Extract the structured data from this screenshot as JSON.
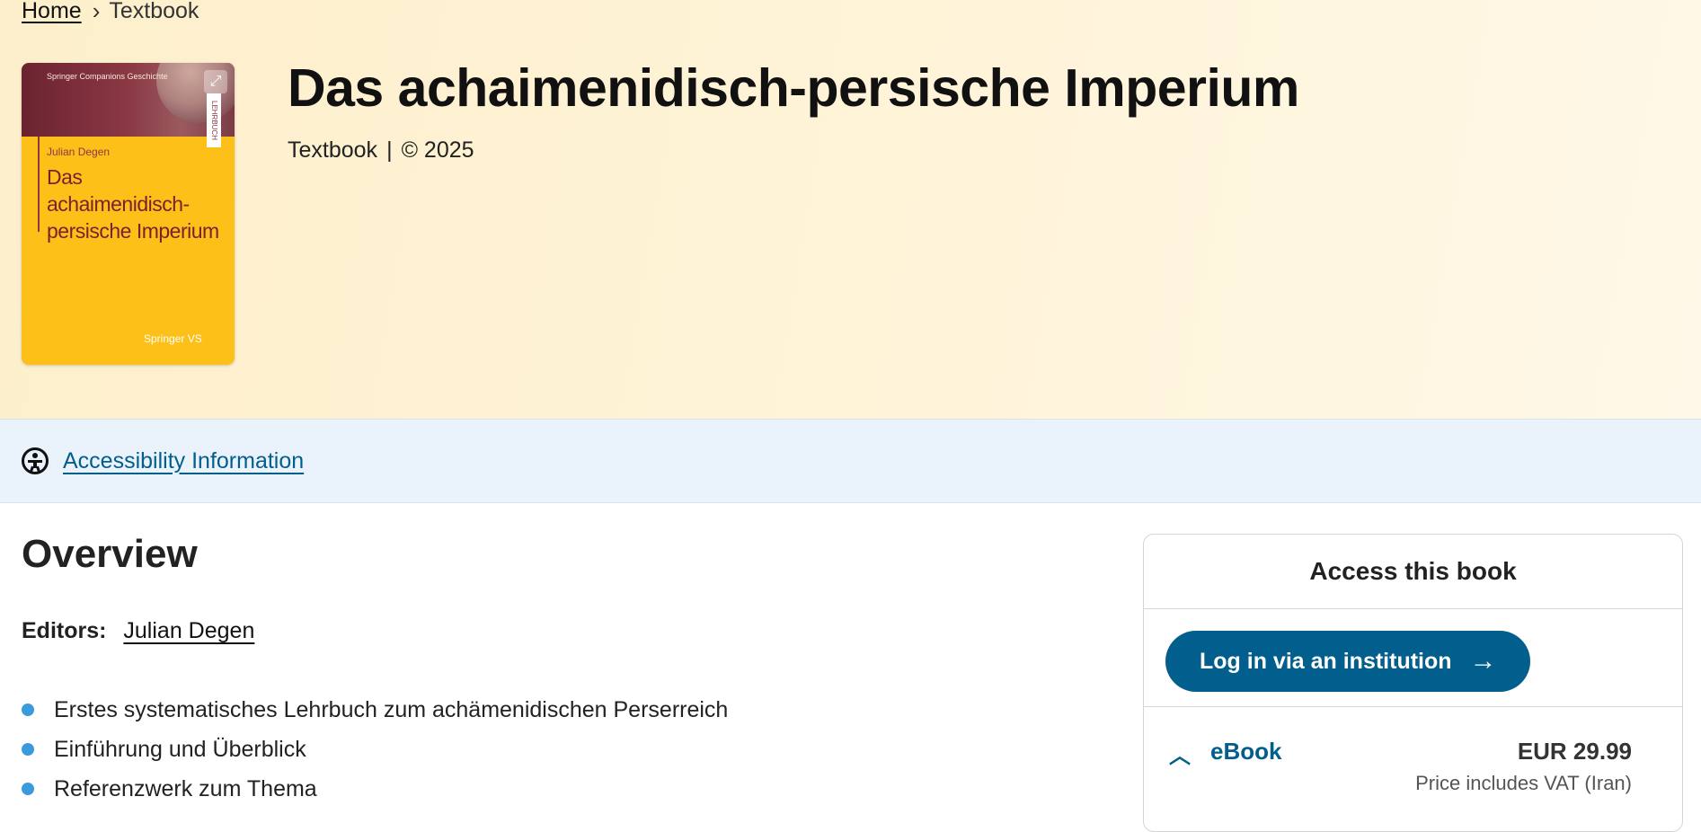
{
  "breadcrumb": {
    "home": "Home",
    "current": "Textbook"
  },
  "cover": {
    "series": "Springer Companions Geschichte",
    "author": "Julian Degen",
    "title": "Das achaimenidisch-persische Imperium",
    "publisher": "Springer VS",
    "tag": "LEHRBUCH"
  },
  "book": {
    "title": "Das achaimenidisch-persische Imperium",
    "type": "Textbook",
    "divider": "|",
    "copyright": "© 2025"
  },
  "accessibility": {
    "link": "Accessibility Information"
  },
  "overview": {
    "heading": "Overview",
    "editors_label": "Editors:",
    "editor_name": "Julian Degen",
    "bullets": [
      "Erstes systematisches Lehrbuch zum achämenidischen Perserreich",
      "Einführung und Überblick",
      "Referenzwerk zum Thema"
    ]
  },
  "access": {
    "title": "Access this book",
    "login": "Log in via an institution",
    "login_arrow": "→",
    "ebook_label": "eBook",
    "ebook_price": "EUR 29.99",
    "vat_note": "Price includes VAT (Iran)"
  },
  "icons": {
    "breadcrumb_separator": "chevron-right-icon",
    "accessibility": "accessibility-icon",
    "expand": "expand-icon",
    "chevron": "chevron-up-icon",
    "bullet": "bullet-dot-icon"
  },
  "colors": {
    "link_blue": "#025e8d",
    "bullet_blue": "#3a9bdc",
    "cover_yellow": "#fdc018",
    "cover_maroon": "#7a2131",
    "hero_bg": "#fdefcb",
    "a11y_bg": "#eaf3fb"
  }
}
